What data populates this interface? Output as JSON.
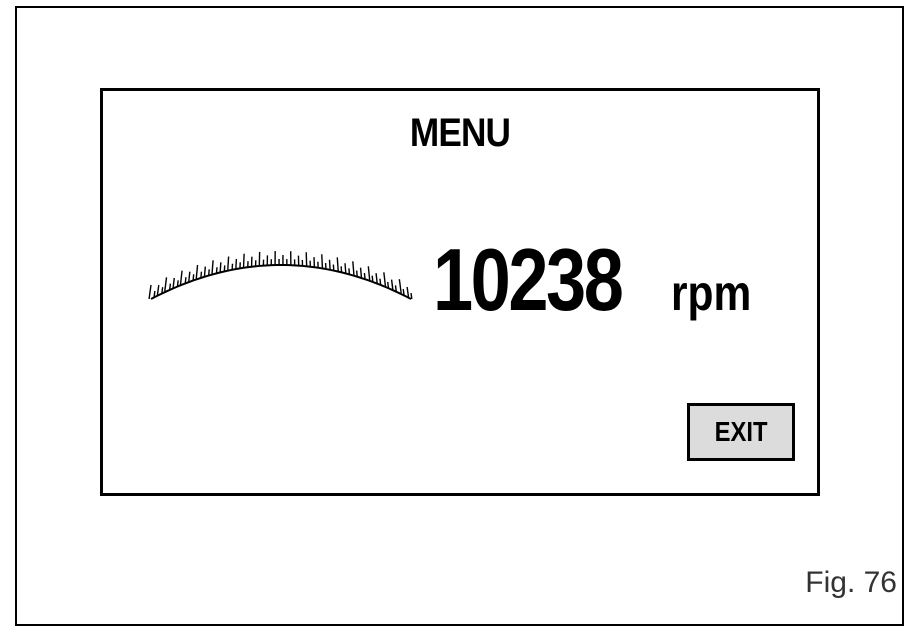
{
  "screen": {
    "title": "MENU",
    "rpm_value": "10238",
    "rpm_unit": "rpm",
    "exit_label": "EXIT"
  },
  "figure": {
    "label": "Fig. 76"
  },
  "gauge": {
    "type": "tachometer-tick-arc",
    "tick_count": 68
  }
}
